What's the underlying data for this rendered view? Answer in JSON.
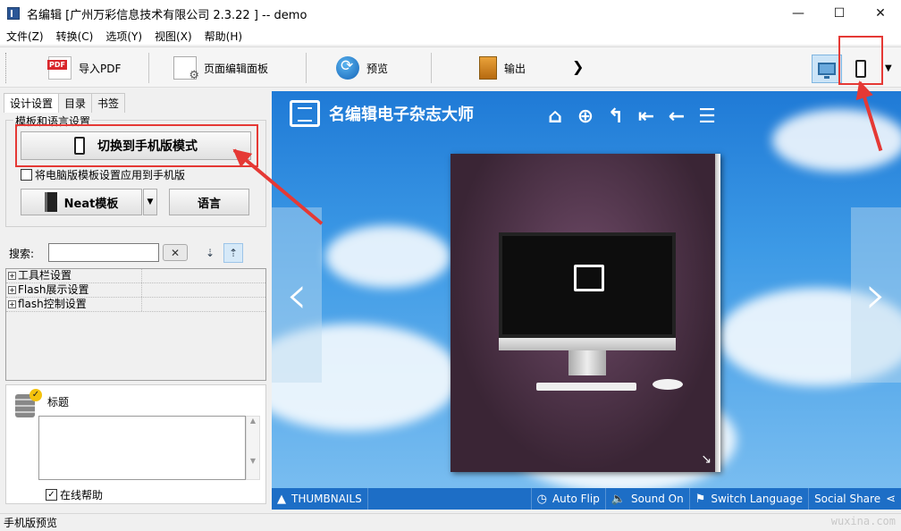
{
  "window": {
    "title": "名编辑 [广州万彩信息技术有限公司 2.3.22 ] -- demo",
    "controls": {
      "minimize": "—",
      "maximize": "☐",
      "close": "✕"
    }
  },
  "menu": [
    "文件(Z)",
    "转换(C)",
    "选项(Y)",
    "视图(X)",
    "帮助(H)"
  ],
  "toolbar": {
    "import_pdf": "导入PDF",
    "page_editor": "页面编辑面板",
    "preview": "预览",
    "output": "输出",
    "more": "❯"
  },
  "tabs": [
    "设计设置",
    "目录",
    "书签"
  ],
  "template_group": {
    "label": "模板和语言设置",
    "switch_mobile": "切换到手机版模式",
    "apply_pc_to_mobile": "将电脑版模板设置应用到手机版",
    "apply_checked": false,
    "neat_template": "Neat模板",
    "language": "语言"
  },
  "search": {
    "label": "搜索:",
    "value": "",
    "clear": "✕"
  },
  "tree": [
    "工具栏设置",
    "Flash展示设置",
    "flash控制设置"
  ],
  "help": {
    "title": "标题",
    "online_help": "在线帮助",
    "online_checked": true
  },
  "preview": {
    "brand": "名编辑电子杂志大师",
    "bottom_bar": {
      "thumbnails": "THUMBNAILS",
      "auto_flip": "Auto Flip",
      "sound_on": "Sound On",
      "switch_language": "Switch Language",
      "social_share": "Social Share"
    }
  },
  "statusbar": {
    "text": "手机版预览"
  },
  "watermark": "wuxina.com",
  "colors": {
    "accent_red": "#e53935",
    "preview_blue": "#1d6ec6"
  }
}
